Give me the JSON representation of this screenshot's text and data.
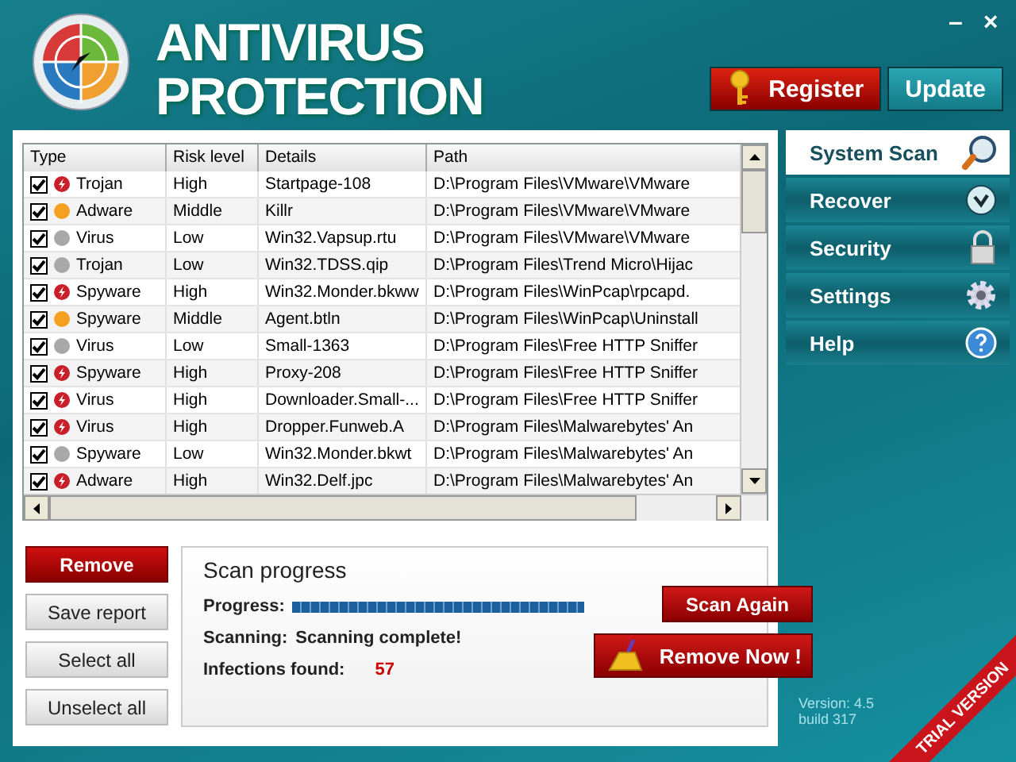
{
  "window": {
    "title_lines": [
      "ANTIVIRUS",
      "PROTECTION"
    ],
    "minimize": "–",
    "close": "×"
  },
  "header_buttons": [
    {
      "label": "Register",
      "kind": "register"
    },
    {
      "label": "Update",
      "kind": "update"
    }
  ],
  "table": {
    "columns": [
      "Type",
      "Risk level",
      "Details",
      "Path"
    ],
    "rows": [
      {
        "checked": true,
        "kind": "high",
        "type": "Trojan",
        "risk": "High",
        "details": "Startpage-108",
        "path": "D:\\Program Files\\VMware\\VMware"
      },
      {
        "checked": true,
        "kind": "middle",
        "type": "Adware",
        "risk": "Middle",
        "details": "Killr",
        "path": "D:\\Program Files\\VMware\\VMware"
      },
      {
        "checked": true,
        "kind": "low",
        "type": "Virus",
        "risk": "Low",
        "details": "Win32.Vapsup.rtu",
        "path": "D:\\Program Files\\VMware\\VMware"
      },
      {
        "checked": true,
        "kind": "low",
        "type": "Trojan",
        "risk": "Low",
        "details": "Win32.TDSS.qip",
        "path": "D:\\Program Files\\Trend Micro\\Hijac"
      },
      {
        "checked": true,
        "kind": "high",
        "type": "Spyware",
        "risk": "High",
        "details": "Win32.Monder.bkww",
        "path": "D:\\Program Files\\WinPcap\\rpcapd."
      },
      {
        "checked": true,
        "kind": "middle",
        "type": "Spyware",
        "risk": "Middle",
        "details": "Agent.btln",
        "path": "D:\\Program Files\\WinPcap\\Uninstall"
      },
      {
        "checked": true,
        "kind": "low",
        "type": "Virus",
        "risk": "Low",
        "details": "Small-1363",
        "path": "D:\\Program Files\\Free HTTP Sniffer"
      },
      {
        "checked": true,
        "kind": "high",
        "type": "Spyware",
        "risk": "High",
        "details": "Proxy-208",
        "path": "D:\\Program Files\\Free HTTP Sniffer"
      },
      {
        "checked": true,
        "kind": "high",
        "type": "Virus",
        "risk": "High",
        "details": "Downloader.Small-...",
        "path": "D:\\Program Files\\Free HTTP Sniffer"
      },
      {
        "checked": true,
        "kind": "high",
        "type": "Virus",
        "risk": "High",
        "details": "Dropper.Funweb.A",
        "path": "D:\\Program Files\\Malwarebytes' An"
      },
      {
        "checked": true,
        "kind": "low",
        "type": "Spyware",
        "risk": "Low",
        "details": "Win32.Monder.bkwt",
        "path": "D:\\Program Files\\Malwarebytes' An"
      },
      {
        "checked": true,
        "kind": "high",
        "type": "Adware",
        "risk": "High",
        "details": "Win32.Delf.jpc",
        "path": "D:\\Program Files\\Malwarebytes' An"
      }
    ]
  },
  "sidebar": {
    "items": [
      {
        "label": "System Scan",
        "selected": true,
        "kind": "search"
      },
      {
        "label": "Recover",
        "selected": false,
        "kind": "recover"
      },
      {
        "label": "Security",
        "selected": false,
        "kind": "lock"
      },
      {
        "label": "Settings",
        "selected": false,
        "kind": "gear"
      },
      {
        "label": "Help",
        "selected": false,
        "kind": "help"
      }
    ]
  },
  "actions": [
    {
      "label": "Remove",
      "kind": "primary"
    },
    {
      "label": "Save report",
      "kind": "plain"
    },
    {
      "label": "Select all",
      "kind": "plain"
    },
    {
      "label": "Unselect all",
      "kind": "plain"
    }
  ],
  "scan": {
    "title": "Scan progress",
    "progress_label": "Progress:",
    "level": 1,
    "scanning_label": "Scanning:",
    "scanning_value": "Scanning complete!",
    "infections_label": "Infections found:",
    "infections_value": "57",
    "scan_again": "Scan Again",
    "remove_now": "Remove Now !"
  },
  "version": {
    "lines": [
      "Version: 4.5",
      "build 317"
    ]
  },
  "ribbon": "TRIAL VERSION"
}
